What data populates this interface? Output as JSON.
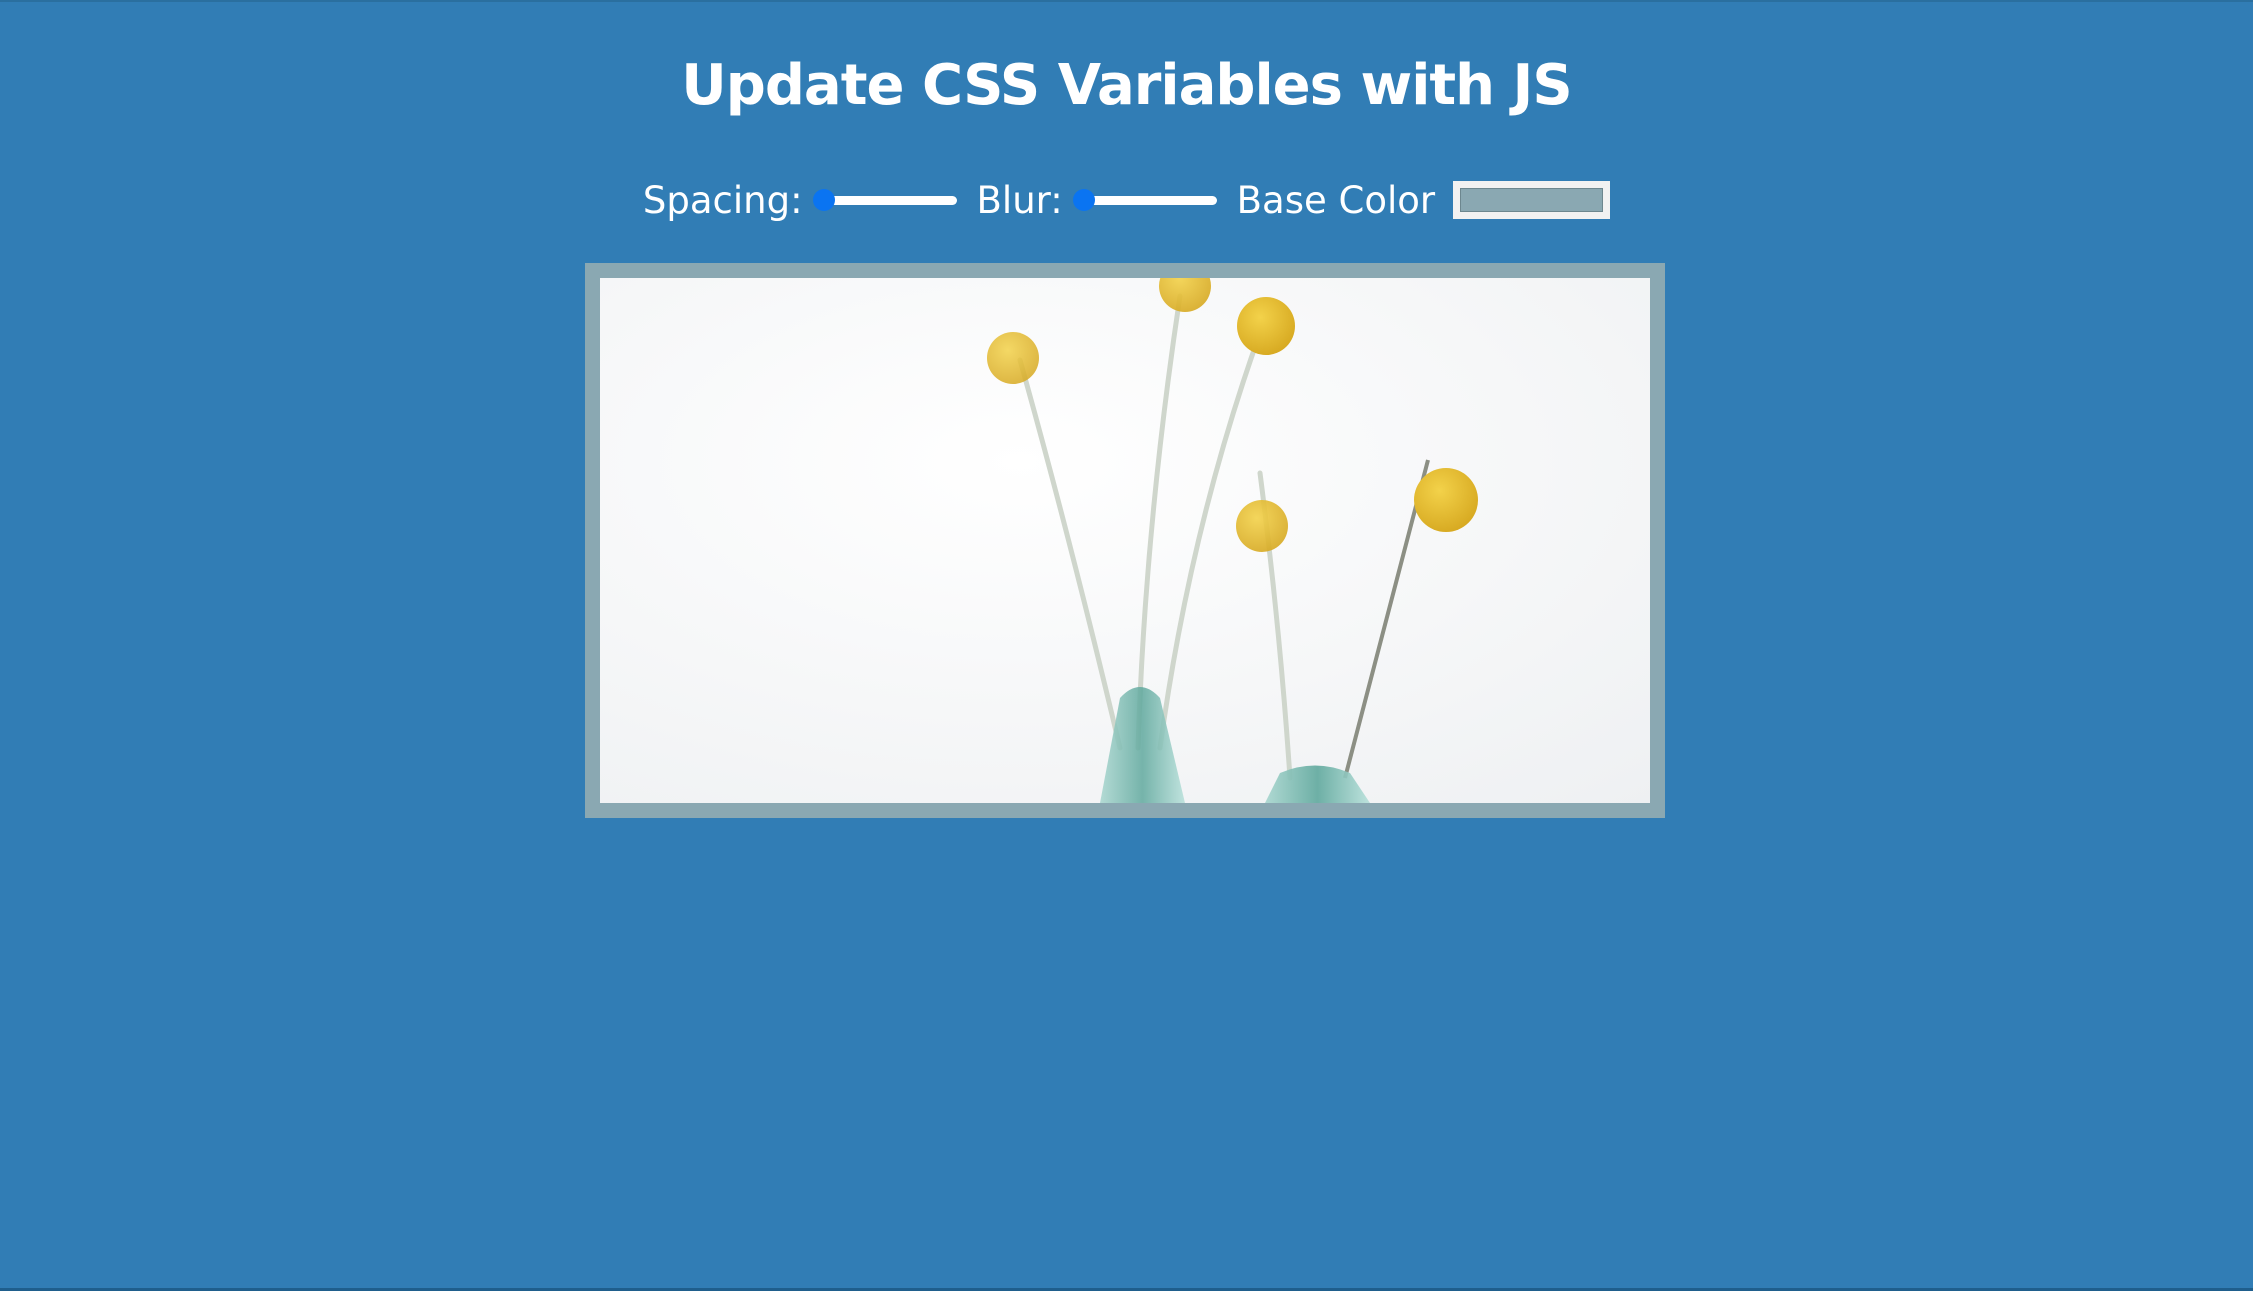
{
  "page": {
    "title": "Update CSS Variables with JS"
  },
  "controls": {
    "spacing": {
      "label": "Spacing:",
      "value": 10,
      "min": 10,
      "max": 200
    },
    "blur": {
      "label": "Blur:",
      "value": 0,
      "min": 0,
      "max": 25
    },
    "base_color": {
      "label": "Base Color",
      "value": "#8aa8b2"
    }
  },
  "colors": {
    "background": "#317db5",
    "accent": "#0a74f2",
    "base": "#8aa8b2"
  },
  "image": {
    "icon": "flowers-photo"
  }
}
